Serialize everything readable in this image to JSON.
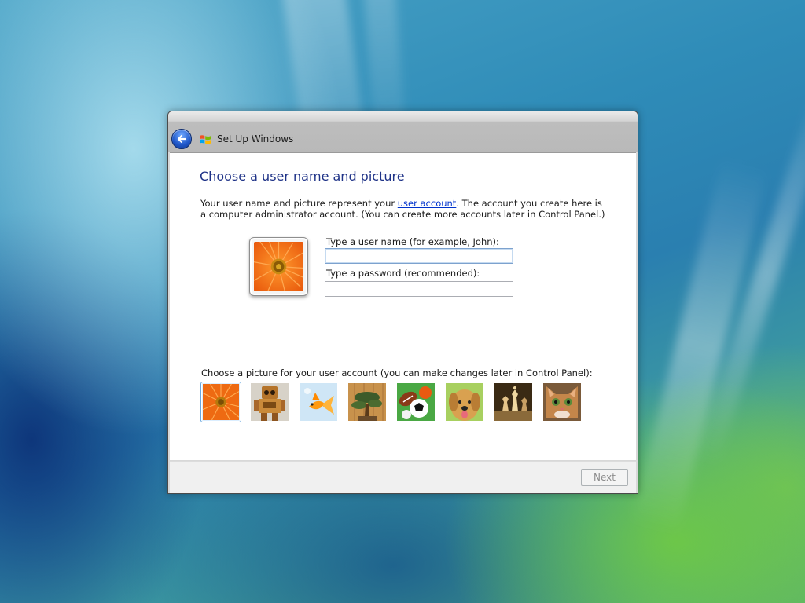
{
  "window": {
    "title": "Set Up Windows",
    "back_icon": "back-arrow-icon",
    "logo_icon": "windows-logo-icon"
  },
  "main": {
    "heading": "Choose a user name and picture",
    "desc_part1": "Your user name and picture represent your ",
    "desc_link": "user account",
    "desc_part2": ". The account you create here is a computer administrator account. (You can create more accounts later in Control Panel.)",
    "username_label": "Type a user name (for example, John):",
    "username_value": "",
    "password_label": "Type a password (recommended):",
    "password_value": "",
    "choose_label": "Choose a picture for your user account (you can make changes later in Control Panel):"
  },
  "pictures": [
    {
      "name": "flower",
      "icon": "flower-picture",
      "selected": true
    },
    {
      "name": "robot",
      "icon": "robot-picture",
      "selected": false
    },
    {
      "name": "fish",
      "icon": "fish-picture",
      "selected": false
    },
    {
      "name": "bonsai",
      "icon": "bonsai-picture",
      "selected": false
    },
    {
      "name": "sports balls",
      "icon": "balls-picture",
      "selected": false
    },
    {
      "name": "dog",
      "icon": "dog-picture",
      "selected": false
    },
    {
      "name": "chess",
      "icon": "chess-picture",
      "selected": false
    },
    {
      "name": "cat",
      "icon": "cat-picture",
      "selected": false
    }
  ],
  "footer": {
    "next_label": "Next",
    "next_enabled": false
  },
  "colors": {
    "heading": "#1e3287",
    "link": "#0033cc",
    "selection": "#6aa6dc"
  }
}
